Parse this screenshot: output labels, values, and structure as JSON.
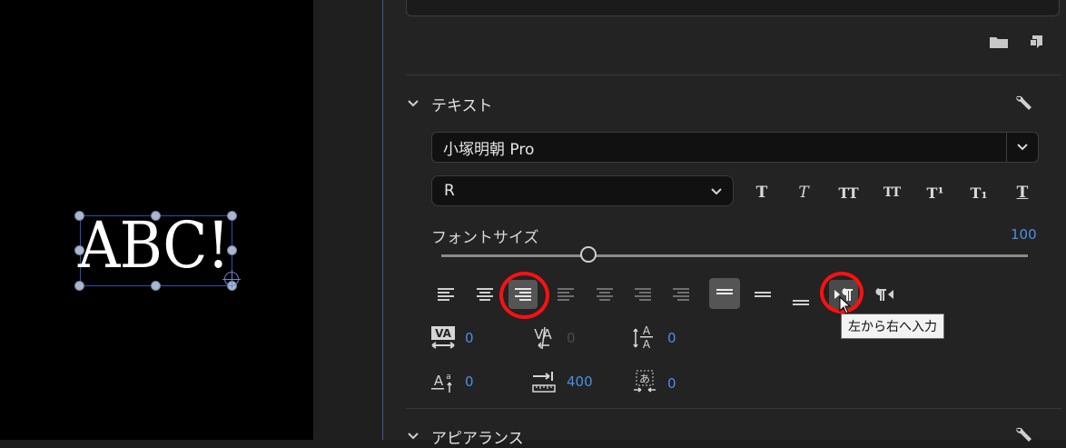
{
  "preview": {
    "sample_text": "ABC!"
  },
  "text_section": {
    "header": "テキスト",
    "font_family": "小塚明朝 Pro",
    "font_style": "R",
    "font_size_label": "フォントサイズ",
    "font_size_value": "100",
    "font_size_slider_fraction": 0.25,
    "text_style_buttons": [
      {
        "name": "faux-bold",
        "glyph": "T"
      },
      {
        "name": "faux-italic",
        "glyph": "T"
      },
      {
        "name": "all-caps",
        "glyph": "TT"
      },
      {
        "name": "small-caps",
        "glyph": "TT"
      },
      {
        "name": "superscript",
        "glyph": "T¹"
      },
      {
        "name": "subscript",
        "glyph": "T₁"
      },
      {
        "name": "underline",
        "glyph": "T"
      }
    ],
    "tracking_value": "0",
    "kerning_value": "0",
    "leading_value": "0",
    "baseline_shift_value": "0",
    "tab_width_value": "400",
    "tsume_value": "0",
    "tooltip": "左から右へ入力"
  },
  "appearance_section": {
    "header": "アピアランス"
  },
  "colors": {
    "accent": "#4a8fe6",
    "annotation": "#ff1010"
  }
}
